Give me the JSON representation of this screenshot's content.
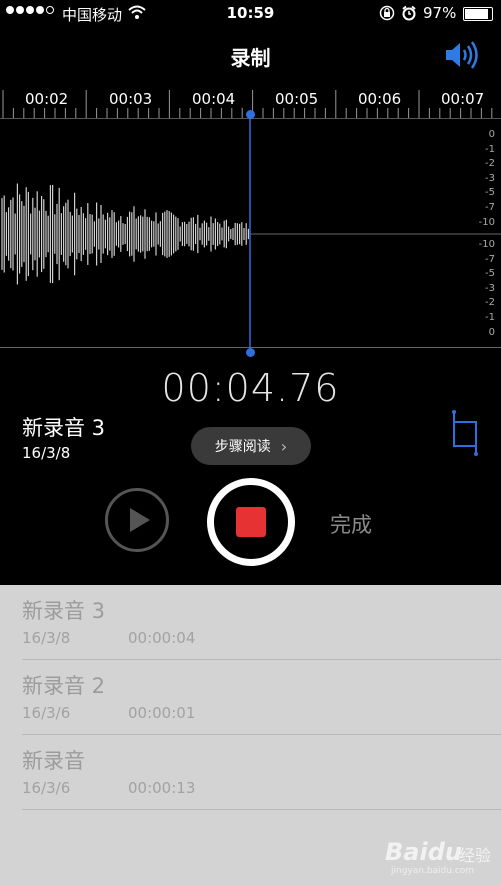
{
  "status_bar": {
    "carrier": "中国移动",
    "time": "10:59",
    "battery": "97%",
    "battery_level": 0.97,
    "signal_dots_filled": 4,
    "icons": [
      "wifi-icon",
      "orientation-lock-icon",
      "alarm-icon",
      "battery-icon"
    ]
  },
  "header": {
    "title": "录制",
    "speaker_icon": "speaker-icon"
  },
  "timeline": {
    "labels": [
      "00:02",
      "00:03",
      "00:04",
      "00:05",
      "00:06",
      "00:07"
    ]
  },
  "waveform": {
    "db_scale_top": [
      "0",
      "-1",
      "-2",
      "-3",
      "-5",
      "-7",
      "-10"
    ],
    "db_scale_bottom": [
      "-10",
      "-7",
      "-5",
      "-3",
      "-2",
      "-1",
      "0"
    ],
    "playhead_color": "#2f6fe0"
  },
  "recording": {
    "timer": "00:04.76",
    "name": "新录音 3",
    "date": "16/3/8",
    "tip_pill": "步骤阅读",
    "done_label": "完成",
    "record_color": "#e63232"
  },
  "recordings_list": [
    {
      "name": "新录音 3",
      "date": "16/3/8",
      "duration": "00:00:04"
    },
    {
      "name": "新录音 2",
      "date": "16/3/6",
      "duration": "00:00:01"
    },
    {
      "name": "新录音",
      "date": "16/3/6",
      "duration": "00:00:13"
    }
  ],
  "watermark": {
    "brand": "Baidu",
    "experience": "经验",
    "url": "jingyan.baidu.com"
  }
}
